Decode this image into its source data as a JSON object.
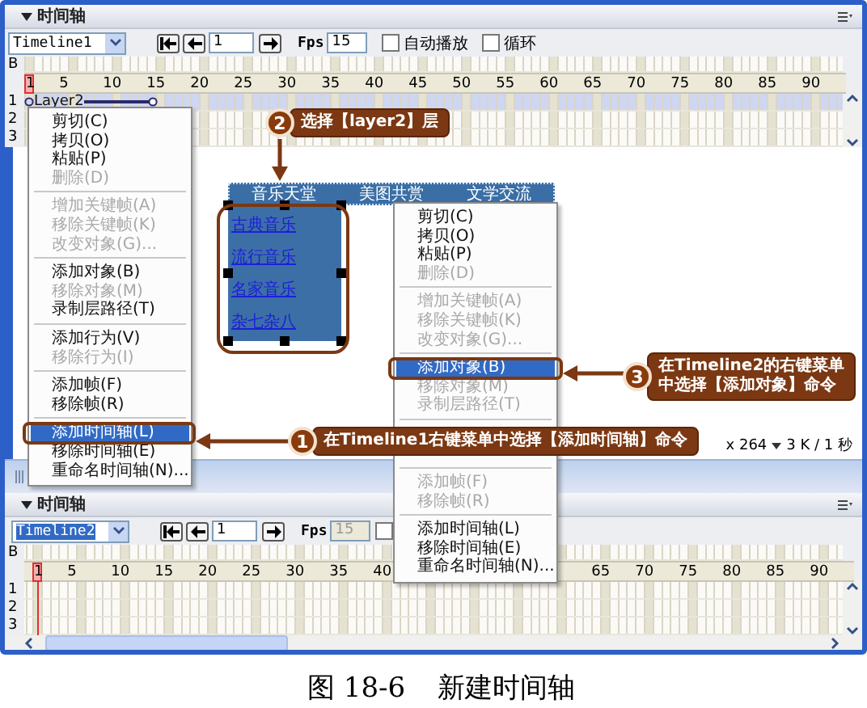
{
  "panels": [
    {
      "title": "时间轴",
      "timeline": "Timeline1",
      "text_selected": false,
      "frame": "1",
      "fps_label": "Fps",
      "fps": "15",
      "fps_disabled": false,
      "checkboxes": [
        {
          "label": "自动播放",
          "checked": false
        },
        {
          "label": "循环",
          "checked": false
        }
      ],
      "b_label": "B",
      "ruler_segments": [
        [
          {
            "label": "1",
            "current": true
          },
          {
            "label": "5",
            "current": false
          },
          {
            "label": "10",
            "current": false
          },
          {
            "label": "15",
            "current": false
          },
          {
            "label": "20",
            "current": false
          },
          {
            "label": "25",
            "current": false
          },
          {
            "label": "30",
            "current": false
          },
          {
            "label": "35",
            "current": false
          },
          {
            "label": "40",
            "current": false
          },
          {
            "label": "45",
            "current": false
          },
          {
            "label": "50",
            "current": false
          },
          {
            "label": "55",
            "current": false
          },
          {
            "label": "60",
            "current": false
          },
          {
            "label": "65",
            "current": false
          },
          {
            "label": "70",
            "current": false
          },
          {
            "label": "75",
            "current": false
          },
          {
            "label": "80",
            "current": false
          },
          {
            "label": "85",
            "current": false
          },
          {
            "label": "90",
            "current": false
          }
        ]
      ],
      "rows": [
        {
          "number": "1",
          "layer": "Layer2",
          "selected": true
        },
        {
          "number": "2",
          "selected": false
        },
        {
          "number": "3",
          "selected": false
        }
      ]
    },
    {
      "title": "时间轴",
      "timeline": "Timeline2",
      "text_selected": true,
      "frame": "1",
      "fps_label": "Fps",
      "fps": "15",
      "fps_disabled": true,
      "checkboxes": [
        {
          "checked": false
        }
      ],
      "b_label": "B",
      "ruler_segments": [
        [
          {
            "label": "1",
            "current": true
          },
          {
            "label": "5",
            "current": false
          },
          {
            "label": "10",
            "current": false
          },
          {
            "label": "15",
            "current": false
          },
          {
            "label": "20",
            "current": false
          },
          {
            "label": "25",
            "current": false
          },
          {
            "label": "30",
            "current": false
          },
          {
            "label": "35",
            "current": false
          },
          {
            "label": "40",
            "current": false
          }
        ],
        [
          {
            "label": "65",
            "current": false
          },
          {
            "label": "70",
            "current": false
          },
          {
            "label": "75",
            "current": false
          },
          {
            "label": "80",
            "current": false
          },
          {
            "label": "85",
            "current": false
          },
          {
            "label": "90",
            "current": false
          }
        ]
      ],
      "rows": [
        {
          "number": "1",
          "selected": false
        },
        {
          "number": "2",
          "selected": false
        },
        {
          "number": "3",
          "selected": false
        }
      ]
    }
  ],
  "design": {
    "nav": [
      "音乐天堂",
      "美图共赏",
      "文学交流"
    ],
    "links": [
      "古典音乐",
      "流行音乐",
      "名家音乐",
      "杂七杂八"
    ]
  },
  "status": [
    "x 264",
    "3 K / 1 秒"
  ],
  "menus": [
    {
      "items": [
        {
          "kind": "item",
          "label": "剪切(C)",
          "disabled": false,
          "selected": false
        },
        {
          "kind": "item",
          "label": "拷贝(O)",
          "disabled": false,
          "selected": false
        },
        {
          "kind": "item",
          "label": "粘贴(P)",
          "disabled": false,
          "selected": false
        },
        {
          "kind": "item",
          "label": "删除(D)",
          "disabled": true,
          "selected": false
        },
        {
          "kind": "separator"
        },
        {
          "kind": "item",
          "label": "增加关键帧(A)",
          "disabled": true,
          "selected": false
        },
        {
          "kind": "item",
          "label": "移除关键帧(K)",
          "disabled": true,
          "selected": false
        },
        {
          "kind": "item",
          "label": "改变对象(G)...",
          "disabled": true,
          "selected": false
        },
        {
          "kind": "separator"
        },
        {
          "kind": "item",
          "label": "添加对象(B)",
          "disabled": false,
          "selected": false
        },
        {
          "kind": "item",
          "label": "移除对象(M)",
          "disabled": true,
          "selected": false
        },
        {
          "kind": "item",
          "label": "录制层路径(T)",
          "disabled": false,
          "selected": false
        },
        {
          "kind": "separator"
        },
        {
          "kind": "item",
          "label": "添加行为(V)",
          "disabled": false,
          "selected": false
        },
        {
          "kind": "item",
          "label": "移除行为(I)",
          "disabled": true,
          "selected": false
        },
        {
          "kind": "separator"
        },
        {
          "kind": "item",
          "label": "添加帧(F)",
          "disabled": false,
          "selected": false
        },
        {
          "kind": "item",
          "label": "移除帧(R)",
          "disabled": false,
          "selected": false
        },
        {
          "kind": "separator"
        },
        {
          "kind": "item",
          "label": "添加时间轴(L)",
          "disabled": false,
          "selected": true
        },
        {
          "kind": "item",
          "label": "移除时间轴(E)",
          "disabled": false,
          "selected": false
        },
        {
          "kind": "item",
          "label": "重命名时间轴(N)...",
          "disabled": false,
          "selected": false
        }
      ]
    },
    {
      "items": [
        {
          "kind": "item",
          "label": "剪切(C)",
          "disabled": false,
          "selected": false
        },
        {
          "kind": "item",
          "label": "拷贝(O)",
          "disabled": false,
          "selected": false
        },
        {
          "kind": "item",
          "label": "粘贴(P)",
          "disabled": false,
          "selected": false
        },
        {
          "kind": "item",
          "label": "删除(D)",
          "disabled": true,
          "selected": false
        },
        {
          "kind": "separator"
        },
        {
          "kind": "item",
          "label": "增加关键帧(A)",
          "disabled": true,
          "selected": false
        },
        {
          "kind": "item",
          "label": "移除关键帧(K)",
          "disabled": true,
          "selected": false
        },
        {
          "kind": "item",
          "label": "改变对象(G)...",
          "disabled": true,
          "selected": false
        },
        {
          "kind": "separator"
        },
        {
          "kind": "item",
          "label": "添加对象(B)",
          "disabled": false,
          "selected": true
        },
        {
          "kind": "item",
          "label": "移除对象(M)",
          "disabled": true,
          "selected": false
        },
        {
          "kind": "item",
          "label": "录制层路径(T)",
          "disabled": true,
          "selected": false
        },
        {
          "kind": "separator"
        },
        {
          "kind": "gap"
        },
        {
          "kind": "separator"
        },
        {
          "kind": "item",
          "label": "添加帧(F)",
          "disabled": true,
          "selected": false
        },
        {
          "kind": "item",
          "label": "移除帧(R)",
          "disabled": true,
          "selected": false
        },
        {
          "kind": "separator"
        },
        {
          "kind": "item",
          "label": "添加时间轴(L)",
          "disabled": false,
          "selected": false
        },
        {
          "kind": "item",
          "label": "移除时间轴(E)",
          "disabled": false,
          "selected": false
        },
        {
          "kind": "item",
          "label": "重命名时间轴(N)...",
          "disabled": false,
          "selected": false
        }
      ]
    }
  ],
  "callouts": [
    {
      "number": "2",
      "lines": [
        "选择【layer2】层"
      ]
    },
    {
      "number": "3",
      "lines": [
        "在Timeline2的右键菜单",
        "中选择【添加对象】命令"
      ]
    },
    {
      "number": "1",
      "lines": [
        "在Timeline1右键菜单中选择【添加时间轴】命令"
      ]
    }
  ],
  "caption": {
    "figure": "图 18-6",
    "title": "新建时间轴"
  }
}
